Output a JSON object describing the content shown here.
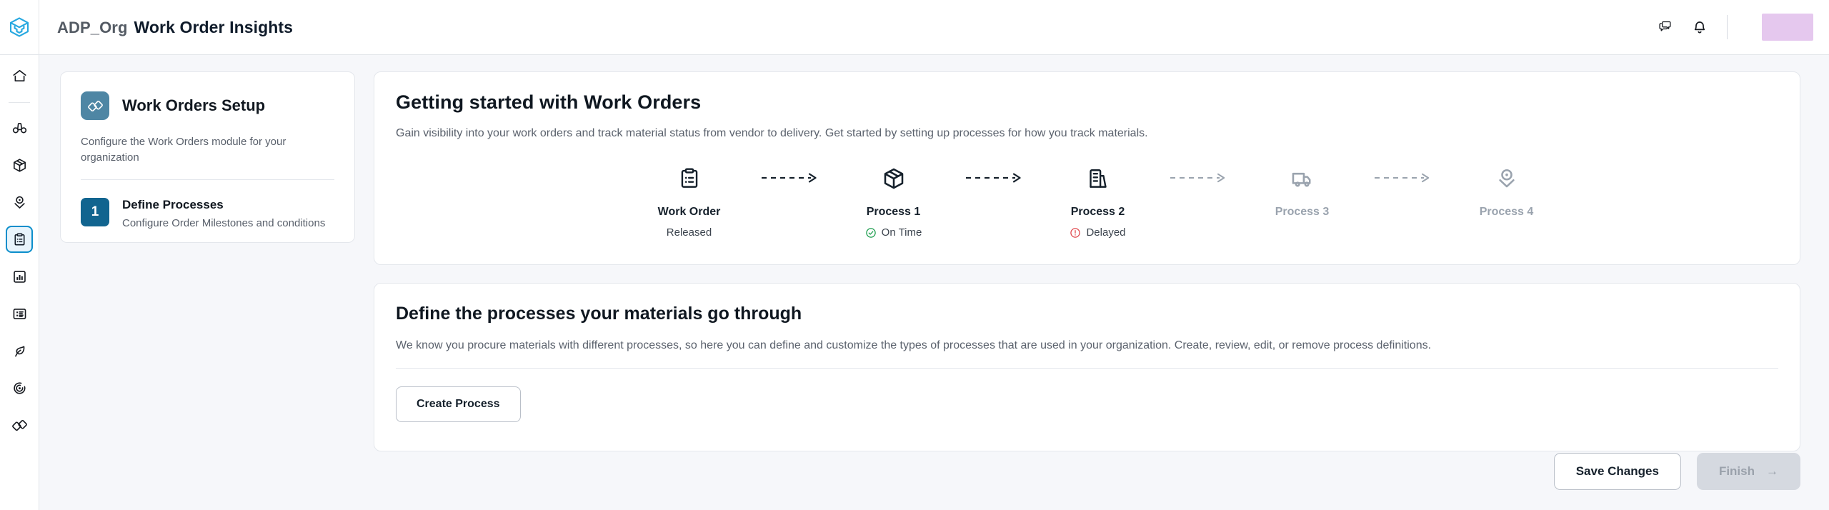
{
  "header": {
    "logo_icon": "cube-logo-icon",
    "org": "ADP_Org",
    "title": "Work Order Insights",
    "actions": [
      {
        "name": "chat-icon",
        "label": "Chat"
      },
      {
        "name": "bell-icon",
        "label": "Notifications"
      }
    ],
    "avatar_label": "",
    "avatar_color": "#e5c8ee"
  },
  "sidebar": {
    "items": [
      {
        "icon": "home-icon",
        "label": "Home",
        "active": false
      },
      {
        "icon": "binoculars-icon",
        "label": "Discover",
        "active": false
      },
      {
        "icon": "package-icon",
        "label": "Shipments",
        "active": false
      },
      {
        "icon": "location-pin-icon",
        "label": "Tracking",
        "active": false
      },
      {
        "icon": "clipboard-list-icon",
        "label": "Work Orders",
        "active": true
      },
      {
        "icon": "bar-chart-icon",
        "label": "Analytics",
        "active": false
      },
      {
        "icon": "list-details-icon",
        "label": "Records",
        "active": false
      },
      {
        "icon": "leaf-icon",
        "label": "Sustainability",
        "active": false
      },
      {
        "icon": "target-icon",
        "label": "Goals",
        "active": false
      },
      {
        "icon": "diamonds-icon",
        "label": "Work Orders Setup",
        "active": false
      }
    ]
  },
  "setup_card": {
    "icon": "diamonds-icon",
    "title": "Work Orders Setup",
    "subtitle": "Configure the Work Orders module for your organization",
    "steps": [
      {
        "number": "1",
        "title": "Define Processes",
        "subtitle": "Configure Order Milestones and conditions"
      }
    ]
  },
  "getting_started": {
    "heading": "Getting started with Work Orders",
    "description": "Gain visibility into your work orders and track material status from vendor to delivery. Get started by setting up processes for how you track materials.",
    "flow": [
      {
        "icon": "clipboard-list-icon",
        "label": "Work Order",
        "status": "Released",
        "status_type": "plain",
        "muted": false
      },
      {
        "icon": "package-icon",
        "label": "Process 1",
        "status": "On Time",
        "status_type": "ok",
        "muted": false
      },
      {
        "icon": "factory-icon",
        "label": "Process 2",
        "status": "Delayed",
        "status_type": "error",
        "muted": false
      },
      {
        "icon": "truck-icon",
        "label": "Process 3",
        "status": "",
        "status_type": "none",
        "muted": true
      },
      {
        "icon": "location-pin-icon",
        "label": "Process 4",
        "status": "",
        "status_type": "none",
        "muted": true
      }
    ],
    "status_colors": {
      "ok": "#1a9c4c",
      "error": "#e0474c"
    }
  },
  "define_section": {
    "heading": "Define the processes your materials go through",
    "description": "We know you procure materials with different processes, so here you can define and customize the types of processes that are used in your organization. Create, review, edit, or remove process definitions.",
    "create_button": "Create Process"
  },
  "footer": {
    "save_label": "Save Changes",
    "finish_label": "Finish",
    "finish_arrow": "→",
    "finish_disabled": true
  }
}
